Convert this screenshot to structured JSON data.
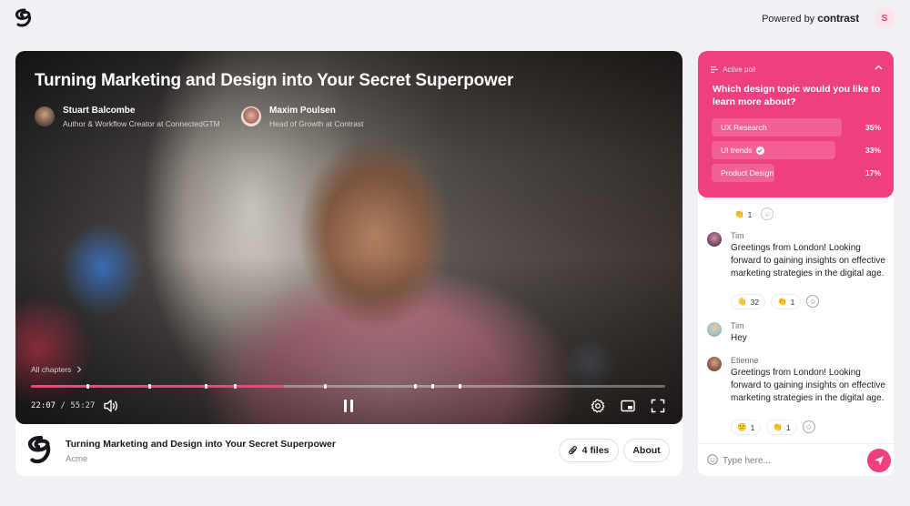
{
  "header": {
    "powered_by": "Powered by",
    "brand": "contrast",
    "user_initial": "S"
  },
  "video": {
    "title": "Turning Marketing and Design into Your Secret Superpower",
    "speakers": [
      {
        "name": "Stuart Balcombe",
        "role": "Author & Workflow Creator at ConnectedGTM"
      },
      {
        "name": "Maxim Poulsen",
        "role": "Head of Growth at Contrast"
      }
    ],
    "chapters_label": "All chapters",
    "current_time": "22:07",
    "separator": "/",
    "total_time": "55:27",
    "progress_fraction": 0.399
  },
  "event": {
    "title": "Turning Marketing and Design into Your Secret Superpower",
    "organizer": "Acme",
    "files_label": "4 files",
    "about_label": "About"
  },
  "poll": {
    "header": "Active poll",
    "question": "Which design topic would you like to learn more about?",
    "options": [
      {
        "label": "UX Research",
        "percent": "35%",
        "value": 0.35
      },
      {
        "label": "UI trends",
        "percent": "33%",
        "value": 0.33,
        "voted": true
      },
      {
        "label": "Product Design",
        "percent": "17%",
        "value": 0.17
      }
    ]
  },
  "chat": {
    "partial_reaction_count": "1",
    "messages": [
      {
        "author": "Tim",
        "text": "Greetings from London! Looking forward to gaining insights on effective marketing strategies in the digital age.",
        "reactions": [
          {
            "emoji": "👋",
            "count": "32"
          },
          {
            "emoji": "👏",
            "count": "1"
          }
        ]
      },
      {
        "author": "Tim",
        "text": "Hey",
        "reactions": []
      },
      {
        "author": "Etienne",
        "text": "Greetings from London! Looking forward to gaining insights on effective marketing strategies in the digital age.",
        "reactions": [
          {
            "emoji": "😕",
            "count": "1"
          },
          {
            "emoji": "👏",
            "count": "1"
          }
        ]
      }
    ],
    "input_placeholder": "Type here..."
  },
  "colors": {
    "accent": "#ee3f7e",
    "background": "#f1f0f5"
  }
}
